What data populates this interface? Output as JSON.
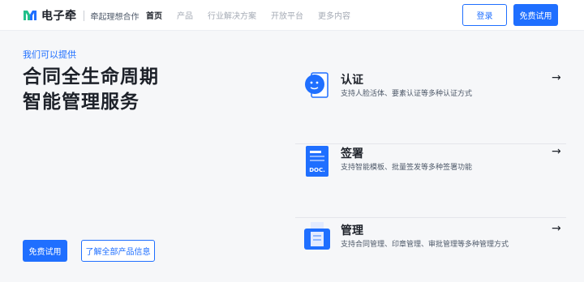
{
  "brand": {
    "name": "电子牵",
    "slogan": "牵起理想合作",
    "colors": {
      "primary": "#1f6fff",
      "logo_green": "#22c08a",
      "logo_blue": "#1f6fff"
    }
  },
  "nav": {
    "items": [
      {
        "label": "首页",
        "active": true
      },
      {
        "label": "产品",
        "active": false
      },
      {
        "label": "行业解决方案",
        "active": false
      },
      {
        "label": "开放平台",
        "active": false
      },
      {
        "label": "更多内容",
        "active": false
      }
    ],
    "login_label": "登录",
    "trial_label": "免费试用"
  },
  "hero": {
    "eyebrow": "我们可以提供",
    "headline_line1": "合同全生命周期",
    "headline_line2": "智能管理服务",
    "primary_button": "免费试用",
    "secondary_button": "了解全部产品信息"
  },
  "features": [
    {
      "title": "认证",
      "desc": "支持人脸活体、要素认证等多种认证方式",
      "icon": "face-id-icon"
    },
    {
      "title": "签署",
      "desc": "支持智能模板、批量签发等多种签署功能",
      "icon": "document-icon",
      "icon_text": "DOC."
    },
    {
      "title": "管理",
      "desc": "支持合同管理、印章管理、审批管理等多种管理方式",
      "icon": "folder-icon"
    }
  ],
  "arrow_glyph": "→"
}
